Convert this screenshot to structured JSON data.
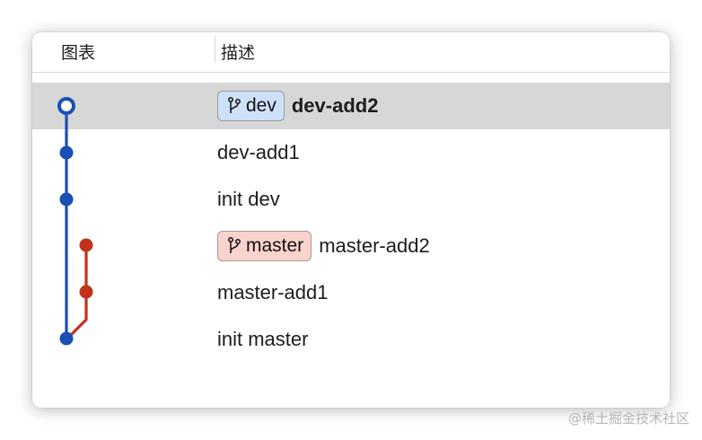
{
  "header": {
    "graph_label": "图表",
    "description_label": "描述"
  },
  "commits": [
    {
      "branch_tag": "dev",
      "message": "dev-add2",
      "selected": true,
      "lane": "dev",
      "node_style": "hollow"
    },
    {
      "branch_tag": null,
      "message": "dev-add1",
      "selected": false,
      "lane": "dev",
      "node_style": "filled"
    },
    {
      "branch_tag": null,
      "message": "init dev",
      "selected": false,
      "lane": "dev",
      "node_style": "filled"
    },
    {
      "branch_tag": "master",
      "message": "master-add2",
      "selected": false,
      "lane": "master",
      "node_style": "filled"
    },
    {
      "branch_tag": null,
      "message": "master-add1",
      "selected": false,
      "lane": "master",
      "node_style": "filled"
    },
    {
      "branch_tag": null,
      "message": "init master",
      "selected": false,
      "lane": "dev",
      "node_style": "filled"
    }
  ],
  "colors": {
    "dev_lane": "#1a4fb5",
    "master_lane": "#c0331a",
    "selected_row": "#d7d7d7",
    "dev_tag_bg": "#cfe0fb",
    "master_tag_bg": "#f9d3cc"
  },
  "icons": {
    "branch_tag_icon": "git-branch-icon"
  },
  "watermark": "@稀土掘金技术社区"
}
